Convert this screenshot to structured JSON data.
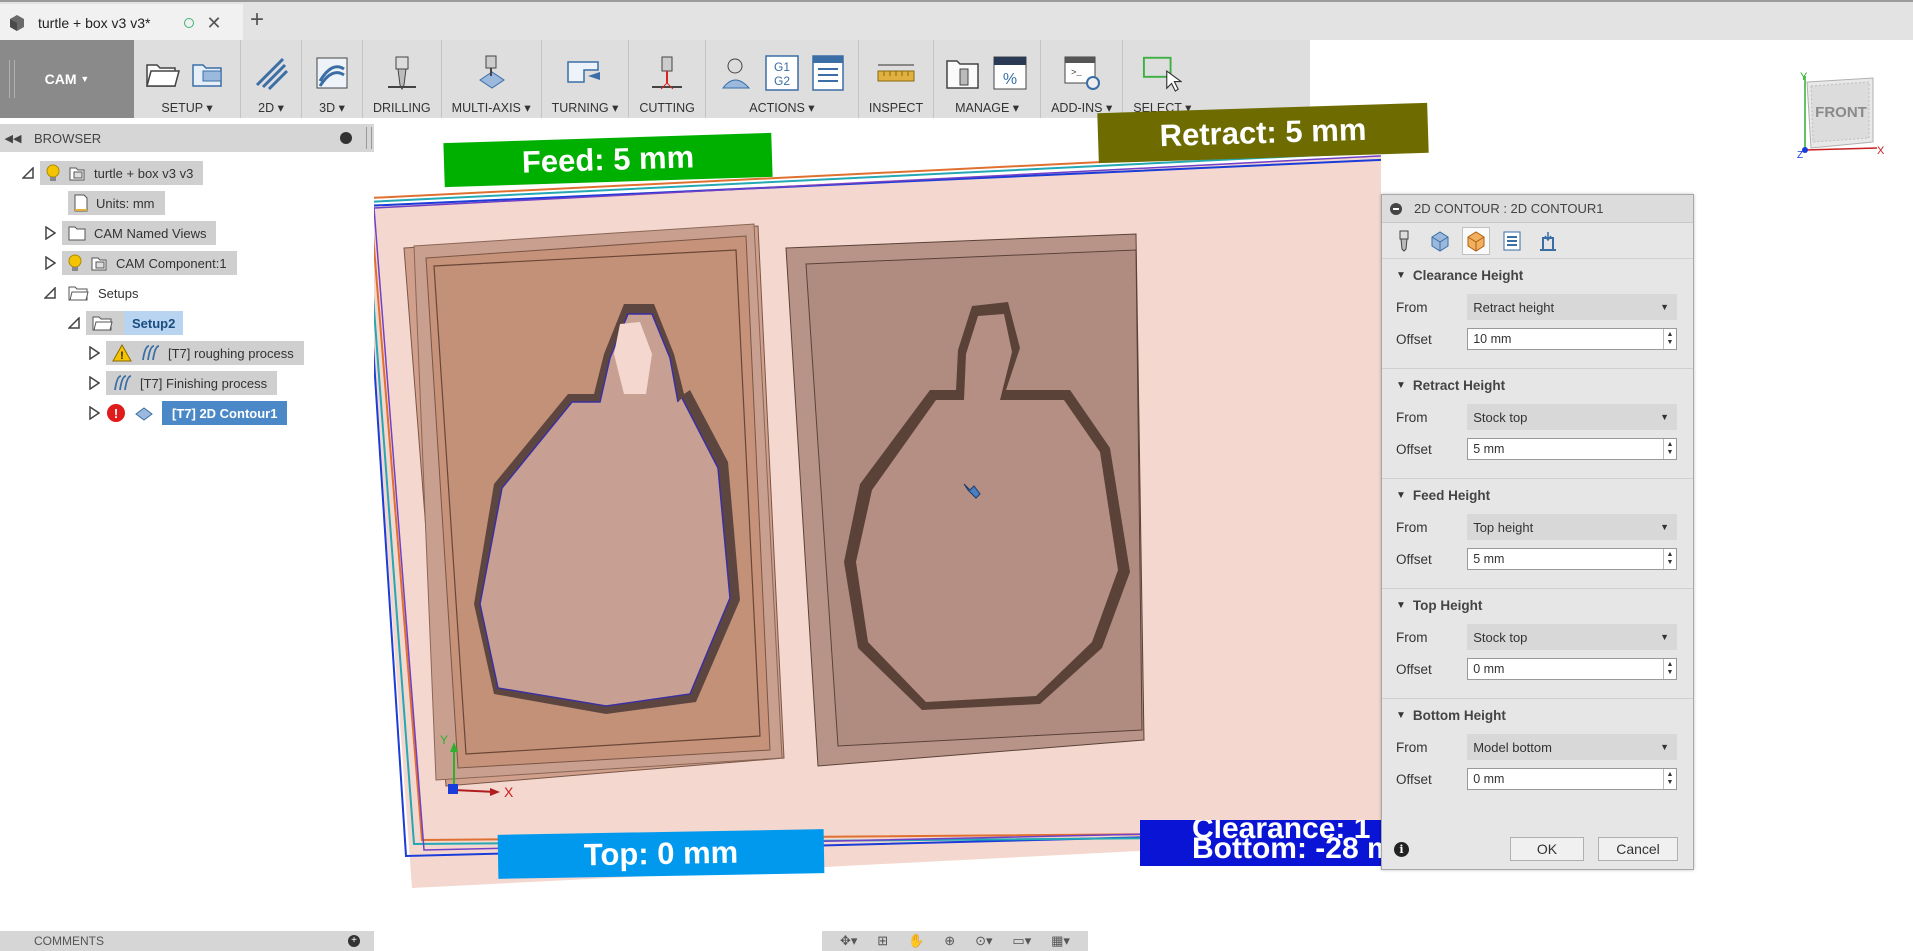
{
  "doc_tab": {
    "title": "turtle + box v3 v3*",
    "new_tab": "+"
  },
  "toolbar": {
    "workspace": "CAM",
    "groups": [
      {
        "label": "SETUP"
      },
      {
        "label": "2D"
      },
      {
        "label": "3D"
      },
      {
        "label": "DRILLING"
      },
      {
        "label": "MULTI-AXIS"
      },
      {
        "label": "TURNING"
      },
      {
        "label": "CUTTING"
      },
      {
        "label": "ACTIONS"
      },
      {
        "label": "INSPECT"
      },
      {
        "label": "MANAGE"
      },
      {
        "label": "ADD-INS"
      },
      {
        "label": "SELECT"
      }
    ],
    "actions_g1g2": [
      "G1",
      "G2"
    ]
  },
  "browser": {
    "title": "BROWSER",
    "root": "turtle + box v3 v3",
    "units": "Units: mm",
    "named_views": "CAM Named Views",
    "component": "CAM Component:1",
    "setups": "Setups",
    "setup": "Setup2",
    "ops": [
      "[T7] roughing process",
      "[T7] Finishing process",
      "[T7] 2D Contour1"
    ]
  },
  "canvas": {
    "feed_label": "Feed: 5 mm",
    "retract_label": "Retract: 5 mm",
    "top_label": "Top: 0 mm",
    "clearance_label": "Clearance: 1",
    "bottom_label": "Bottom: -28 m",
    "axis_x": "X",
    "axis_y": "Y",
    "colors": {
      "feed": "#00b000",
      "retract": "#6e6b00",
      "top": "#0099ee",
      "bottom": "#0a14d4",
      "clearance": "#c21818"
    }
  },
  "dialog": {
    "title": "2D CONTOUR : 2D CONTOUR1",
    "from_label": "From",
    "offset_label": "Offset",
    "sections": [
      {
        "title": "Clearance Height",
        "from": "Retract height",
        "offset": "10 mm"
      },
      {
        "title": "Retract Height",
        "from": "Stock top",
        "offset": "5 mm"
      },
      {
        "title": "Feed Height",
        "from": "Top height",
        "offset": "5 mm"
      },
      {
        "title": "Top Height",
        "from": "Stock top",
        "offset": "0 mm"
      },
      {
        "title": "Bottom Height",
        "from": "Model bottom",
        "offset": "0 mm"
      }
    ],
    "ok": "OK",
    "cancel": "Cancel",
    "info": "i"
  },
  "comments": {
    "title": "COMMENTS"
  },
  "viewcube": {
    "face": "FRONT",
    "x": "X",
    "y": "Y",
    "z": "Z"
  }
}
